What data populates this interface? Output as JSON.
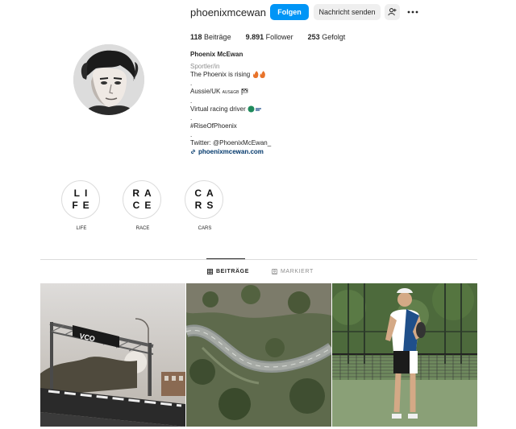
{
  "profile": {
    "username": "phoenixmcewan",
    "follow_label": "Folgen",
    "message_label": "Nachricht senden",
    "stats": {
      "posts_count": "118",
      "posts_label": "Beiträge",
      "followers_count": "9.891",
      "followers_label": "Follower",
      "following_count": "253",
      "following_label": "Gefolgt"
    },
    "bio": {
      "name": "Phoenix McEwan",
      "category": "Sportler/in",
      "line1": "The Phoenix is rising",
      "dot": ".",
      "line2": "Aussie/UK",
      "line2_flag_text": "AUS&GB",
      "line3": "Virtual racing driver",
      "line4": "#RiseOfPhoenix",
      "line5": "Twitter: @PhoenixMcEwan_",
      "link": "phoenixmcewan.com"
    }
  },
  "highlights": [
    {
      "cover_line1": "LI",
      "cover_line2": "FE",
      "label": "LIFE"
    },
    {
      "cover_line1": "RA",
      "cover_line2": "CE",
      "label": "RACE"
    },
    {
      "cover_line1": "CA",
      "cover_line2": "RS",
      "label": "CARS"
    }
  ],
  "tabs": [
    {
      "label": "BEITRÄGE",
      "active": true,
      "icon": "grid-icon"
    },
    {
      "label": "MARKIERT",
      "active": false,
      "icon": "tag-icon"
    }
  ],
  "posts": [
    {
      "description_icon": "race-track-gantry-photo",
      "banner_text": "VCO"
    },
    {
      "description_icon": "aerial-track-photo"
    },
    {
      "description_icon": "padel-court-photo"
    }
  ],
  "colors": {
    "accent": "#0095f6",
    "link": "#00376b",
    "muted": "#8e8e8e",
    "border": "#dbdbdb"
  }
}
